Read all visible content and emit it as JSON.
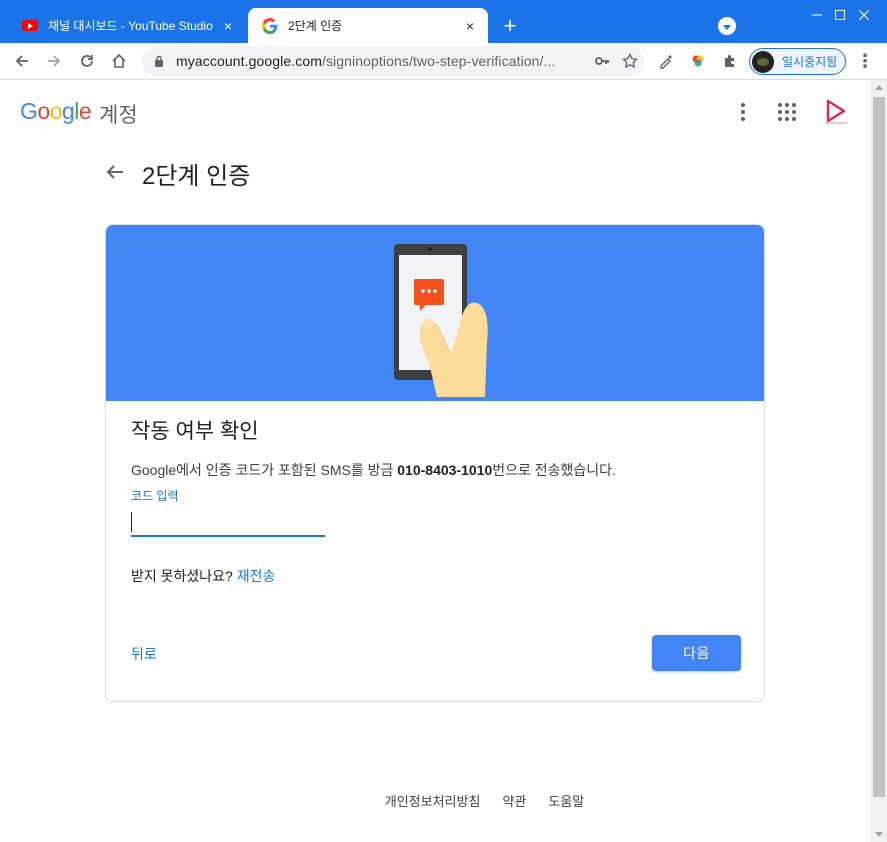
{
  "browser": {
    "tabs": [
      {
        "title": "채널 대시보드 - YouTube Studio",
        "close": "×"
      },
      {
        "title": "2단계 인증",
        "close": "×"
      }
    ],
    "new_tab": "+",
    "window_controls": {
      "minimize": "—",
      "maximize": "☐",
      "close": "✕"
    },
    "url_host": "myaccount.google.com",
    "url_path": "/signinoptions/two-step-verification/...",
    "profile_label": "일시중지됨",
    "menu": "⋮"
  },
  "header": {
    "logo_letters": [
      "G",
      "o",
      "o",
      "g",
      "l",
      "e"
    ],
    "logo_colors": [
      "#4285f4",
      "#ea4335",
      "#fbbc05",
      "#4285f4",
      "#34a853",
      "#ea4335"
    ],
    "account_word": "계정"
  },
  "page": {
    "title": "2단계 인증"
  },
  "card": {
    "heading": "작동 여부 확인",
    "desc_prefix": "Google에서 인증 코드가 포함된 SMS를 방금 ",
    "phone": "010-8403-1010",
    "desc_suffix": "번으로 전송했습니다.",
    "code_label": "코드 입력",
    "code_value": "",
    "not_received": "받지 못하셨나요? ",
    "resend": "재전송",
    "back": "뒤로",
    "next": "다음"
  },
  "footer": {
    "links": [
      "개인정보처리방침",
      "약관",
      "도움말"
    ]
  },
  "colors": {
    "accent": "#1a73e8",
    "hero": "#4285f4",
    "bubble": "#f4511e"
  }
}
